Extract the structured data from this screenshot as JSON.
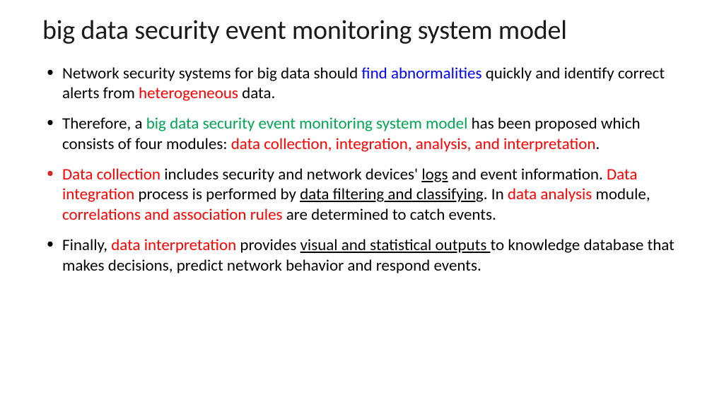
{
  "title": "big data security event monitoring system model",
  "bullets": {
    "b1": {
      "t1": "Network security systems for big data should ",
      "blue1": "find abnormalities ",
      "t2": "quickly and identify correct alerts from ",
      "red1": "heterogeneous ",
      "t3": "data."
    },
    "b2": {
      "t1": "Therefore, a ",
      "green1": "big data security event monitoring system model ",
      "t2": "has been proposed which consists of four modules: ",
      "red1": "data collection, integration, analysis, and interpretation",
      "t3": "."
    },
    "b3": {
      "red1": "Data collection ",
      "t1": "includes security and network devices' ",
      "u1": "logs",
      "t2": " and event information. ",
      "red2": "Data integration ",
      "t3": "process is performed by ",
      "u2": "data filtering and classifying",
      "t4": ". In ",
      "red3": "data analysis ",
      "t5": "module, ",
      "red4": "correlations and association rules ",
      "t6": "are determined to catch events."
    },
    "b4": {
      "t1": "Finally, ",
      "red1": "data interpretation ",
      "t2": "provides ",
      "u1": "visual and statistical outputs ",
      "t3": "to knowledge database that makes decisions, predict network behavior and respond events."
    }
  }
}
